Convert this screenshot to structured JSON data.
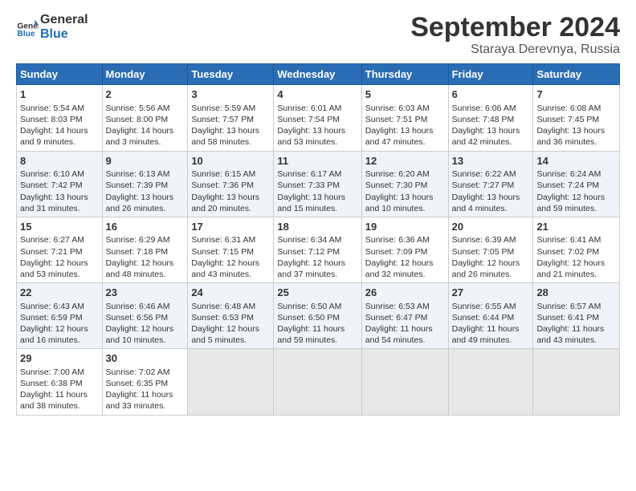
{
  "header": {
    "logo_line1": "General",
    "logo_line2": "Blue",
    "month_title": "September 2024",
    "location": "Staraya Derevnya, Russia"
  },
  "columns": [
    "Sunday",
    "Monday",
    "Tuesday",
    "Wednesday",
    "Thursday",
    "Friday",
    "Saturday"
  ],
  "weeks": [
    [
      {
        "day": "1",
        "info": "Sunrise: 5:54 AM\nSunset: 8:03 PM\nDaylight: 14 hours\nand 9 minutes."
      },
      {
        "day": "2",
        "info": "Sunrise: 5:56 AM\nSunset: 8:00 PM\nDaylight: 14 hours\nand 3 minutes."
      },
      {
        "day": "3",
        "info": "Sunrise: 5:59 AM\nSunset: 7:57 PM\nDaylight: 13 hours\nand 58 minutes."
      },
      {
        "day": "4",
        "info": "Sunrise: 6:01 AM\nSunset: 7:54 PM\nDaylight: 13 hours\nand 53 minutes."
      },
      {
        "day": "5",
        "info": "Sunrise: 6:03 AM\nSunset: 7:51 PM\nDaylight: 13 hours\nand 47 minutes."
      },
      {
        "day": "6",
        "info": "Sunrise: 6:06 AM\nSunset: 7:48 PM\nDaylight: 13 hours\nand 42 minutes."
      },
      {
        "day": "7",
        "info": "Sunrise: 6:08 AM\nSunset: 7:45 PM\nDaylight: 13 hours\nand 36 minutes."
      }
    ],
    [
      {
        "day": "8",
        "info": "Sunrise: 6:10 AM\nSunset: 7:42 PM\nDaylight: 13 hours\nand 31 minutes."
      },
      {
        "day": "9",
        "info": "Sunrise: 6:13 AM\nSunset: 7:39 PM\nDaylight: 13 hours\nand 26 minutes."
      },
      {
        "day": "10",
        "info": "Sunrise: 6:15 AM\nSunset: 7:36 PM\nDaylight: 13 hours\nand 20 minutes."
      },
      {
        "day": "11",
        "info": "Sunrise: 6:17 AM\nSunset: 7:33 PM\nDaylight: 13 hours\nand 15 minutes."
      },
      {
        "day": "12",
        "info": "Sunrise: 6:20 AM\nSunset: 7:30 PM\nDaylight: 13 hours\nand 10 minutes."
      },
      {
        "day": "13",
        "info": "Sunrise: 6:22 AM\nSunset: 7:27 PM\nDaylight: 13 hours\nand 4 minutes."
      },
      {
        "day": "14",
        "info": "Sunrise: 6:24 AM\nSunset: 7:24 PM\nDaylight: 12 hours\nand 59 minutes."
      }
    ],
    [
      {
        "day": "15",
        "info": "Sunrise: 6:27 AM\nSunset: 7:21 PM\nDaylight: 12 hours\nand 53 minutes."
      },
      {
        "day": "16",
        "info": "Sunrise: 6:29 AM\nSunset: 7:18 PM\nDaylight: 12 hours\nand 48 minutes."
      },
      {
        "day": "17",
        "info": "Sunrise: 6:31 AM\nSunset: 7:15 PM\nDaylight: 12 hours\nand 43 minutes."
      },
      {
        "day": "18",
        "info": "Sunrise: 6:34 AM\nSunset: 7:12 PM\nDaylight: 12 hours\nand 37 minutes."
      },
      {
        "day": "19",
        "info": "Sunrise: 6:36 AM\nSunset: 7:09 PM\nDaylight: 12 hours\nand 32 minutes."
      },
      {
        "day": "20",
        "info": "Sunrise: 6:39 AM\nSunset: 7:05 PM\nDaylight: 12 hours\nand 26 minutes."
      },
      {
        "day": "21",
        "info": "Sunrise: 6:41 AM\nSunset: 7:02 PM\nDaylight: 12 hours\nand 21 minutes."
      }
    ],
    [
      {
        "day": "22",
        "info": "Sunrise: 6:43 AM\nSunset: 6:59 PM\nDaylight: 12 hours\nand 16 minutes."
      },
      {
        "day": "23",
        "info": "Sunrise: 6:46 AM\nSunset: 6:56 PM\nDaylight: 12 hours\nand 10 minutes."
      },
      {
        "day": "24",
        "info": "Sunrise: 6:48 AM\nSunset: 6:53 PM\nDaylight: 12 hours\nand 5 minutes."
      },
      {
        "day": "25",
        "info": "Sunrise: 6:50 AM\nSunset: 6:50 PM\nDaylight: 11 hours\nand 59 minutes."
      },
      {
        "day": "26",
        "info": "Sunrise: 6:53 AM\nSunset: 6:47 PM\nDaylight: 11 hours\nand 54 minutes."
      },
      {
        "day": "27",
        "info": "Sunrise: 6:55 AM\nSunset: 6:44 PM\nDaylight: 11 hours\nand 49 minutes."
      },
      {
        "day": "28",
        "info": "Sunrise: 6:57 AM\nSunset: 6:41 PM\nDaylight: 11 hours\nand 43 minutes."
      }
    ],
    [
      {
        "day": "29",
        "info": "Sunrise: 7:00 AM\nSunset: 6:38 PM\nDaylight: 11 hours\nand 38 minutes."
      },
      {
        "day": "30",
        "info": "Sunrise: 7:02 AM\nSunset: 6:35 PM\nDaylight: 11 hours\nand 33 minutes."
      },
      {
        "day": "",
        "info": ""
      },
      {
        "day": "",
        "info": ""
      },
      {
        "day": "",
        "info": ""
      },
      {
        "day": "",
        "info": ""
      },
      {
        "day": "",
        "info": ""
      }
    ]
  ]
}
